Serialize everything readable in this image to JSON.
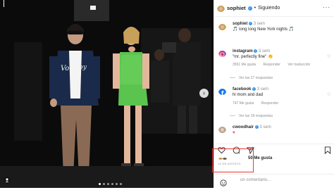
{
  "post": {
    "username": "sophiet",
    "separator": "•",
    "follow_label": "Siguiendo",
    "more_label": "···",
    "caption": {
      "username": "sophiet",
      "text": "🎵 long long New York nights 🎵",
      "time": "3 sem"
    },
    "comments": [
      {
        "username": "instagram",
        "time": "3 sem",
        "text": "\"mr. perfectly fine\" 👏",
        "likes": "3591 Me gusta",
        "reply_label": "Responder",
        "translate_label": "Ver traducción",
        "replies": "Ver las 27 respuestas",
        "avatar_color": "#d6249f"
      },
      {
        "username": "facebook",
        "time": "3 sem",
        "text": "hi mom and dad",
        "likes": "747 Me gusta",
        "reply_label": "Responder",
        "replies": "Ver las 18 respuestas",
        "avatar_color": "#1877f2"
      },
      {
        "username": "cwoodhair",
        "time": "3 sem",
        "text": "♥",
        "avatar_color": "#b8a48f"
      }
    ],
    "likes_count": "50 Me gusta",
    "date": "14 DE AGOSTO",
    "comment_placeholder": "un comentario...",
    "next_icon": "›"
  },
  "colors": {
    "verified": "#3897f0",
    "dress": "#5ac44f",
    "highlight_box": "#e53935"
  }
}
